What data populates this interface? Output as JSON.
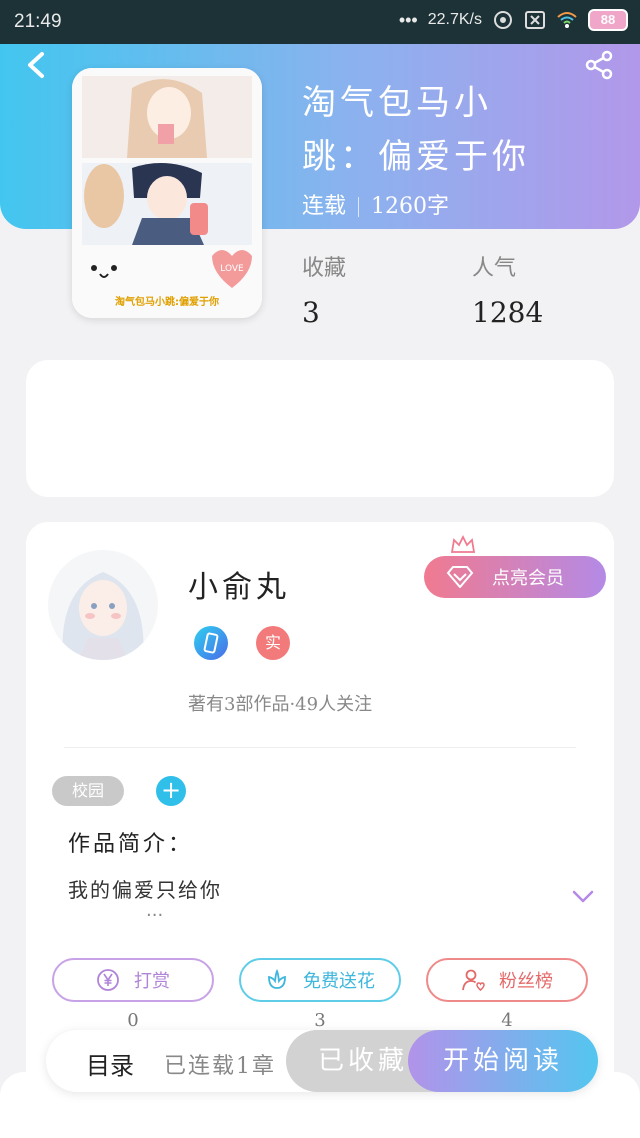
{
  "status_bar": {
    "time": "21:49",
    "network_speed": "22.7K/s",
    "battery": "88"
  },
  "book": {
    "title_line1": "淘气包马小",
    "title_line2": "跳：偏爱于你",
    "status": "连载",
    "word_count": "1260字",
    "cover_caption": "淘气包马小跳:偏爱于你",
    "cover_badge": "LOVE"
  },
  "stats": {
    "favorites_label": "收藏",
    "favorites_value": "3",
    "popularity_label": "人气",
    "popularity_value": "1284"
  },
  "author": {
    "name": "小俞丸",
    "vip_label": "点亮会员",
    "real_badge": "实",
    "summary": "著有3部作品·49人关注"
  },
  "tags": [
    "校园"
  ],
  "intro": {
    "title": "作品简介：",
    "text": "我的偏爱只给你",
    "ellipsis": "..."
  },
  "actions": [
    {
      "label": "打赏",
      "count": "0"
    },
    {
      "label": "免费送花",
      "count": "3"
    },
    {
      "label": "粉丝榜",
      "count": "4"
    }
  ],
  "bottom_bar": {
    "toc_label": "目录",
    "toc_progress": "已连载1章",
    "favorite_label": "已收藏",
    "read_label": "开始阅读"
  },
  "colors": {
    "header_gradient_start": "#42c6ef",
    "header_gradient_end": "#b298ea",
    "vip_gradient_start": "#f07a90",
    "vip_gradient_end": "#b48ae6"
  }
}
